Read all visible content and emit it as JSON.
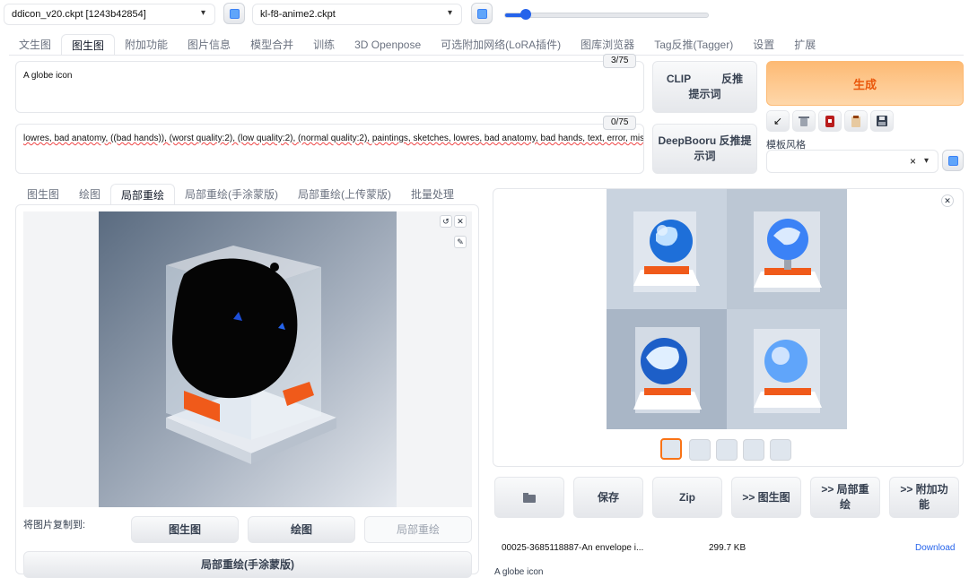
{
  "models": {
    "sd_checkpoint": "ddicon_v20.ckpt [1243b42854]",
    "vae": "kl-f8-anime2.ckpt",
    "slider_level": 0.1
  },
  "main_tabs": [
    "文生图",
    "图生图",
    "附加功能",
    "图片信息",
    "模型合并",
    "训练",
    "3D Openpose",
    "可选附加网络(LoRA插件)",
    "图库浏览器",
    "Tag反推(Tagger)",
    "设置",
    "扩展"
  ],
  "prompt": {
    "positive": "A globe icon",
    "positive_count": "3/75",
    "negative": "lowres, bad anatomy, ((bad hands)), (worst quality:2), (low quality:2), (normal quality:2), paintings, sketches, lowres, bad anatomy, bad hands, text, error, missing fingers,",
    "negative_count": "0/75"
  },
  "interrogate": {
    "clip_1": "CLIP",
    "clip_2": "反推",
    "clip_3": "提示词",
    "deepbooru_1": "DeepBooru 反推提",
    "deepbooru_2": "示词"
  },
  "generate_label": "生成",
  "style": {
    "label": "模板风格",
    "clear": "×"
  },
  "sub_tabs": [
    "图生图",
    "绘图",
    "局部重绘",
    "局部重绘(手涂蒙版)",
    "局部重绘(上传蒙版)",
    "批量处理"
  ],
  "copy_to": {
    "label": "将图片复制到:",
    "btn_img2img": "图生图",
    "btn_sketch": "绘图",
    "btn_inpaint": "局部重绘",
    "btn_inpaint_sketch": "局部重绘(手涂蒙版)"
  },
  "output_actions": {
    "save": "保存",
    "zip": "Zip",
    "to_img2img": ">> 图生图",
    "to_inpaint_1": ">> 局部重",
    "to_inpaint_2": "绘",
    "to_extras_1": ">> 附加功",
    "to_extras_2": "能"
  },
  "file": {
    "name": "00025-3685118887-An envelope i...",
    "size": "299.7 KB",
    "download": "Download",
    "caption": "A globe icon"
  },
  "colors": {
    "accent": "#f97316",
    "generate_start": "#fdba74",
    "generate_end": "#fed7aa",
    "link": "#2563eb"
  }
}
